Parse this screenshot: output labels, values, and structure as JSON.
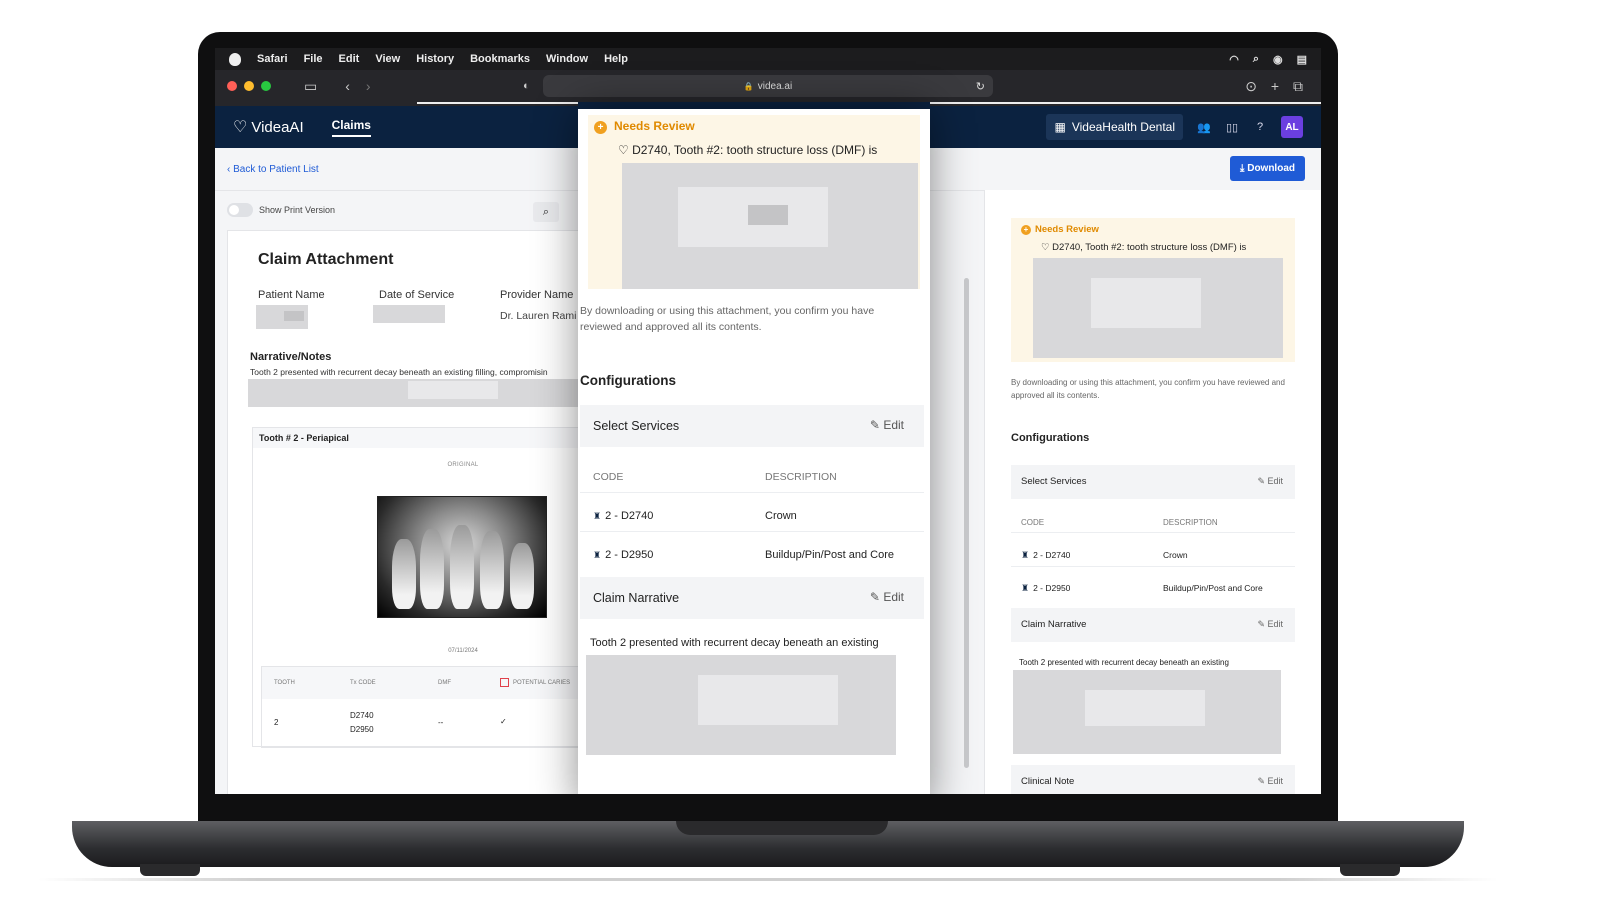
{
  "menubar": {
    "app": "Safari",
    "items": [
      "File",
      "Edit",
      "View",
      "History",
      "Bookmarks",
      "Window",
      "Help"
    ]
  },
  "browser": {
    "url": "videa.ai"
  },
  "header": {
    "logo": "VideaAI",
    "nav_claims": "Claims",
    "practice": "VideaHealth Dental",
    "avatar": "AL"
  },
  "page": {
    "back_link": "Back to Patient List",
    "download": "Download",
    "show_print": "Show Print Version"
  },
  "document": {
    "title": "Claim Attachment",
    "patient_label": "Patient Name",
    "dos_label": "Date of Service",
    "provider_label": "Provider Name",
    "provider_value": "Dr. Lauren Rami",
    "narrative_title": "Narrative/Notes",
    "narrative_text": "Tooth 2 presented with recurrent decay beneath an existing filling, compromisin",
    "xray_title": "Tooth # 2 - Periapical",
    "original_label": "ORIGINAL",
    "xray_date": "07/11/2024",
    "table": {
      "headers": [
        "TOOTH",
        "Tx CODE",
        "DMF",
        "POTENTIAL CARIES"
      ],
      "row": {
        "tooth": "2",
        "code1": "D2740",
        "code2": "D2950",
        "dmf": "--",
        "caries": "✓"
      }
    }
  },
  "review": {
    "needs_review": "Needs Review",
    "finding": "D2740, Tooth #2: tooth structure loss (DMF) is",
    "confirm": "By downloading or using this attachment, you confirm you have reviewed and approved all its contents.",
    "configurations": "Configurations",
    "select_services": "Select Services",
    "edit": "Edit",
    "code_header": "CODE",
    "desc_header": "DESCRIPTION",
    "services": [
      {
        "code": "2 - D2740",
        "description": "Crown"
      },
      {
        "code": "2 - D2950",
        "description": "Buildup/Pin/Post and Core"
      }
    ],
    "claim_narrative": "Claim Narrative",
    "narrative_text": "Tooth 2 presented with recurrent decay beneath an existing",
    "clinical_note": "Clinical Note"
  },
  "colors": {
    "navy": "#0b2240",
    "accent_blue": "#1f5bd6",
    "warning": "#e08a00",
    "review_bg": "#fdf6e6",
    "avatar": "#6b3fe0"
  }
}
